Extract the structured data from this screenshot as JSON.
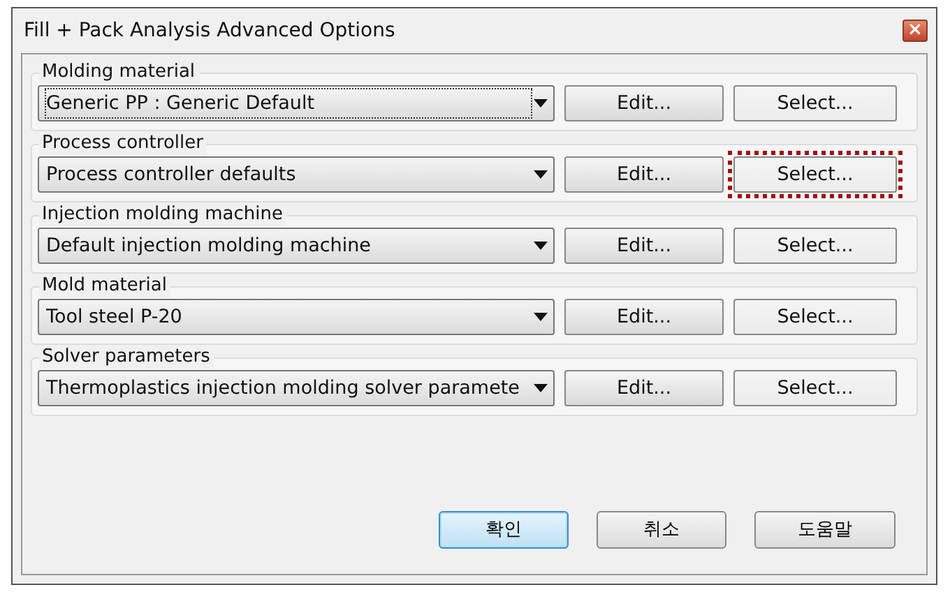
{
  "window": {
    "title": "Fill + Pack Analysis Advanced Options",
    "close_glyph": "×"
  },
  "groups": [
    {
      "label": "Molding material",
      "value": "Generic PP : Generic Default",
      "edit": "Edit...",
      "select": "Select...",
      "highlighted": false,
      "focused": true
    },
    {
      "label": "Process controller",
      "value": "Process controller defaults",
      "edit": "Edit...",
      "select": "Select...",
      "highlighted": true,
      "focused": false
    },
    {
      "label": "Injection molding machine",
      "value": "Default injection molding machine",
      "edit": "Edit...",
      "select": "Select...",
      "highlighted": false,
      "focused": false
    },
    {
      "label": "Mold material",
      "value": "Tool steel P-20",
      "edit": "Edit...",
      "select": "Select...",
      "highlighted": false,
      "focused": false
    },
    {
      "label": "Solver parameters",
      "value": "Thermoplastics injection molding solver paramete",
      "edit": "Edit...",
      "select": "Select...",
      "highlighted": false,
      "focused": false
    }
  ],
  "buttons": [
    {
      "label": "확인",
      "default": true
    },
    {
      "label": "취소",
      "default": false
    },
    {
      "label": "도움말",
      "default": false
    }
  ]
}
